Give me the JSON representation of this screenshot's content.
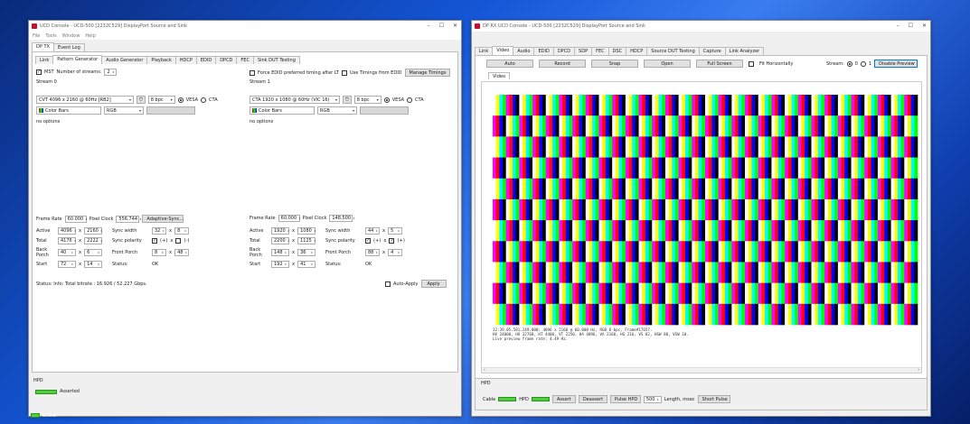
{
  "tx": {
    "title": "UCD Console - UCD-500 [2232C529] DisplayPort Source and Sink",
    "menu": [
      "File",
      "Tools",
      "Window",
      "Help"
    ],
    "top_tabs": [
      "DP TX",
      "Event Log"
    ],
    "sub_tabs": [
      "Link",
      "Pattern Generator",
      "Audio Generator",
      "Playback",
      "HDCP",
      "EDID",
      "DPCD",
      "FEC",
      "Sink DUT Testing"
    ],
    "mst_label": "MST",
    "num_streams_label": "Number of streams:",
    "num_streams": "2",
    "force_edid_label": "Force EDID preferred timing after LT",
    "use_timings_label": "Use Timings from EDID",
    "manage_timings": "Manage Timings",
    "streams": [
      {
        "name": "Stream 0",
        "timing": "CVT 4096 x 2160 @ 60Hz [RB2]",
        "bpc": "8 bpc",
        "vesa": "VESA",
        "cta": "CTA",
        "pattern": "Color Bars",
        "colorspace": "RGB",
        "options": "no options",
        "frame_rate_label": "Frame Rate",
        "frame_rate": "60.000",
        "pixel_clock_label": "Pixel Clock",
        "pixel_clock": "556.744",
        "adaptive_sync": "Adaptive-Sync...",
        "active_label": "Active",
        "active_w": "4096",
        "active_h": "2160",
        "total_label": "Total",
        "total_w": "4176",
        "total_h": "2222",
        "backporch_label": "Back Porch",
        "bp_w": "40",
        "bp_h": "6",
        "start_label": "Start",
        "start_w": "72",
        "start_h": "14",
        "sync_width_label": "Sync width",
        "sw_w": "32",
        "sw_h": "8",
        "sync_polarity_label": "Sync polarity",
        "sp_h": "(+)",
        "sp_v": "(-)",
        "front_porch_label": "Front Porch",
        "fp_w": "8",
        "fp_h": "48",
        "status_label": "Status:",
        "status": "OK"
      },
      {
        "name": "Stream 1",
        "timing": "CTA 1920 x 1080 @ 60Hz (VIC 16)",
        "bpc": "8 bpc",
        "vesa": "VESA",
        "cta": "CTA",
        "pattern": "Color Bars",
        "colorspace": "RGB",
        "options": "no options",
        "frame_rate_label": "Frame Rate",
        "frame_rate": "60.000",
        "pixel_clock_label": "Pixel Clock",
        "pixel_clock": "148.500",
        "active_label": "Active",
        "active_w": "1920",
        "active_h": "1080",
        "total_label": "Total",
        "total_w": "2200",
        "total_h": "1125",
        "backporch_label": "Back Porch",
        "bp_w": "148",
        "bp_h": "36",
        "start_label": "Start",
        "start_w": "192",
        "start_h": "41",
        "sync_width_label": "Sync width",
        "sw_w": "44",
        "sw_h": "5",
        "sync_polarity_label": "Sync polarity",
        "sp_h": "(+)",
        "sp_v": "(+)",
        "front_porch_label": "Front Porch",
        "fp_w": "88",
        "fp_h": "4",
        "status_label": "Status:",
        "status": "OK"
      }
    ],
    "times_sign": "x",
    "status_line": "Status: Info: Total bitrate : 16.926 / 52.227 Gbps.",
    "auto_apply": "Auto-Apply",
    "apply": "Apply",
    "hpd_label": "HPD",
    "hpd_state": "Asserted",
    "online": "online"
  },
  "rx": {
    "title": "DP RX UCD Console - UCD-500 [2232C529] DisplayPort Source and Sink",
    "tabs": [
      "Link",
      "Video",
      "Audio",
      "EDID",
      "DPCD",
      "SDP",
      "FEC",
      "DSC",
      "HDCP",
      "Source DUT Testing",
      "Capture",
      "Link Analyzer"
    ],
    "toolbar": {
      "auto": "Auto",
      "record": "Record",
      "snap": "Snap",
      "open": "Open",
      "full_screen": "Full Screen",
      "fit_horizontally": "Fit Horizontally",
      "stream_label": "Stream:",
      "stream_0": "0",
      "stream_1": "1",
      "disable_preview": "Disable Preview"
    },
    "video_tab": "Video",
    "bars": [
      "#ffffff",
      "#ffff00",
      "#00ffff",
      "#00ff00",
      "#ff00ff",
      "#ff0000",
      "#0000ff",
      "#000000"
    ],
    "status_lines": [
      "12:39.05.581.249.000: 4096 x 2160 @ 60.000 Hz, RGB 8 bpc, Frame#17657.",
      "HV 24000, HV 32768, HT 4400, VT 2250, HA 4096, VA 2160, HS 216, VS 82, HSW 88, VSW 10.",
      "Live preview frame rate: 4.49 Hz."
    ],
    "hpd_label": "HPD",
    "cable_label": "Cable",
    "hpd_inner_label": "HPD",
    "assert": "Assert",
    "deassert": "Deassert",
    "pulse_hpd": "Pulse HPD",
    "pulse_len": "500",
    "length_msec": "Length, msec",
    "short_pulse": "Short Pulse"
  }
}
